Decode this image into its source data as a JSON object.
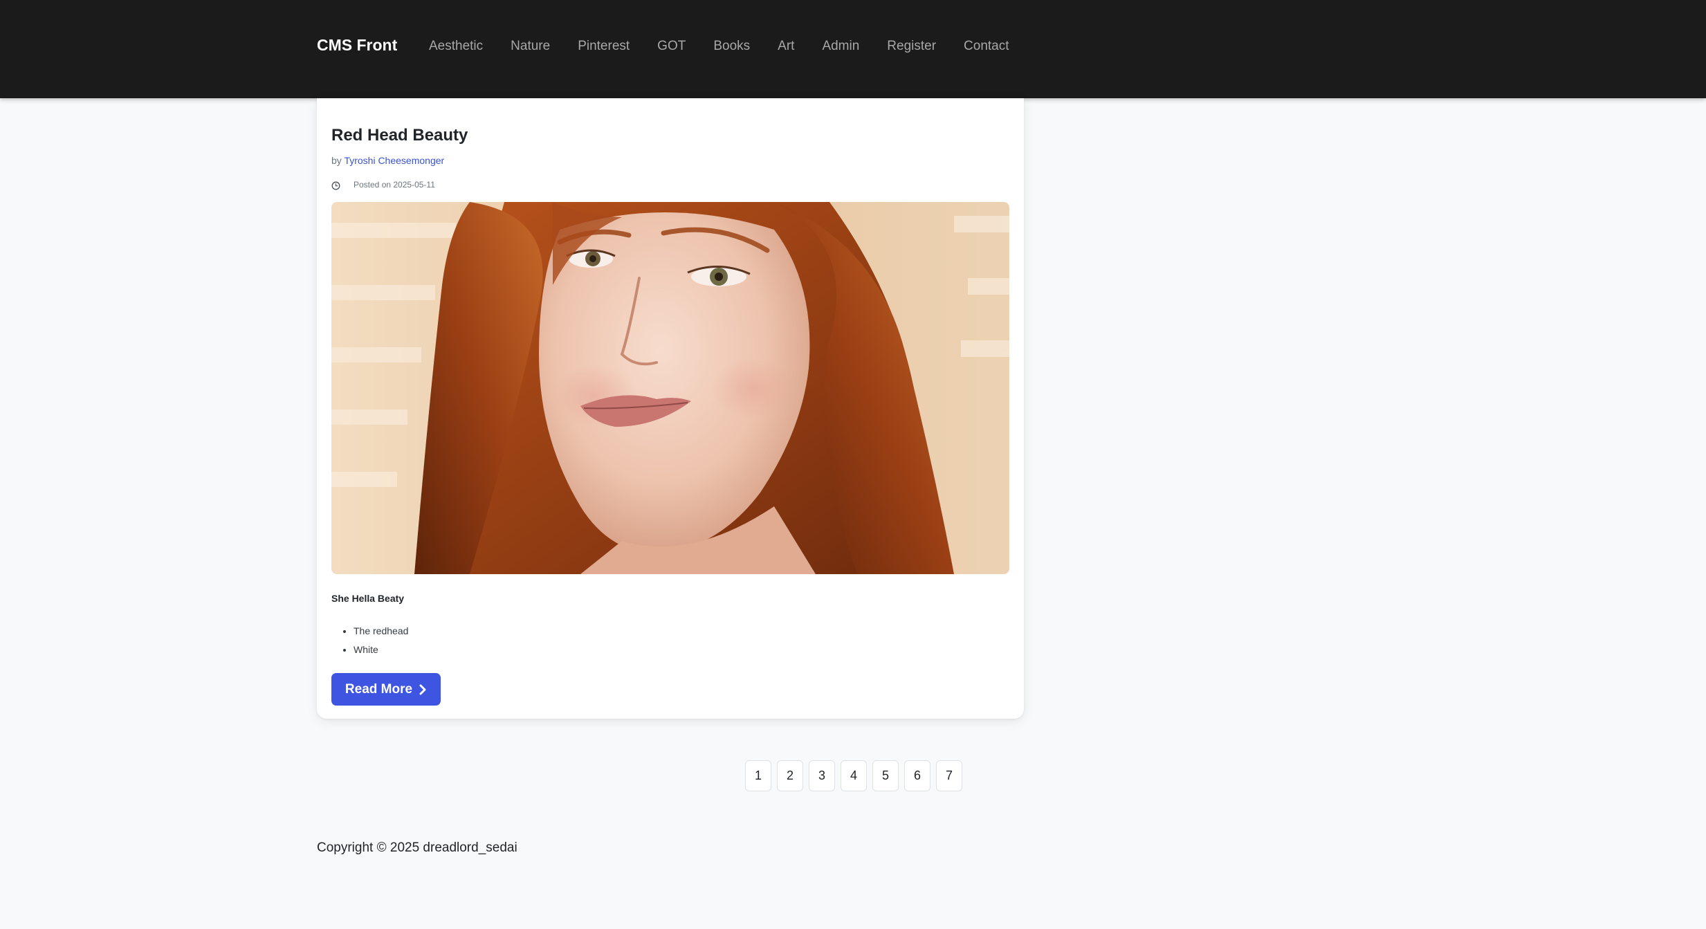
{
  "navbar": {
    "brand": "CMS Front",
    "links": [
      {
        "label": "Aesthetic"
      },
      {
        "label": "Nature"
      },
      {
        "label": "Pinterest"
      },
      {
        "label": "GOT"
      },
      {
        "label": "Books"
      },
      {
        "label": "Art"
      },
      {
        "label": "Admin"
      },
      {
        "label": "Register"
      },
      {
        "label": "Contact"
      }
    ]
  },
  "post": {
    "title": "Red Head Beauty",
    "by_prefix": "by",
    "author": "Tyroshi Cheesemonger",
    "posted_label": "Posted on 2025-05-11",
    "excerpt_heading": "She Hella Beaty",
    "excerpt_items": [
      "The redhead",
      "White"
    ],
    "read_more_label": "Read More"
  },
  "pagination": {
    "pages": [
      "1",
      "2",
      "3",
      "4",
      "5",
      "6",
      "7"
    ]
  },
  "footer": {
    "copyright": "Copyright © 2025 dreadlord_sedai"
  },
  "colors": {
    "navbar_bg": "#1b1b1b",
    "page_bg": "#f8f9fa",
    "accent": "#3e55e2",
    "author_link": "#3a53d6"
  },
  "icons": {
    "posted": "clock-icon",
    "read_more": "chevron-right-icon"
  }
}
